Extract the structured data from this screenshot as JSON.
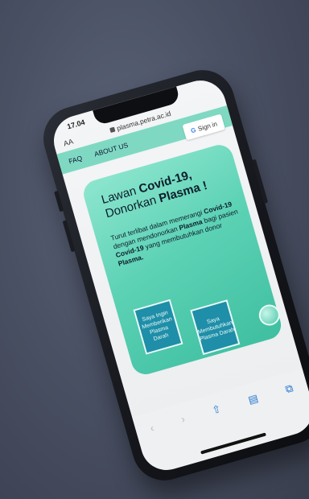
{
  "status": {
    "time": "17.04"
  },
  "browser": {
    "aa": "AA",
    "url": "plasma.petra.ac.id"
  },
  "nav": {
    "faq": "FAQ",
    "about": "ABOUT US",
    "signin": "Sign in",
    "signin_icon": "G"
  },
  "hero": {
    "title_line1": "Lawan",
    "title_line1_bold": "Covid-19,",
    "title_line2": "Donorkan",
    "title_line2_bold": "Plasma !",
    "desc_1": "Turut terlibat dalam memerangi ",
    "desc_bold_1": "Covid-19",
    "desc_2": " dengan mendonorkan ",
    "desc_bold_2": "Plasma",
    "desc_3": " bagi pasien ",
    "desc_bold_3": "Covid-19",
    "desc_4": " yang membutuhkan donor ",
    "desc_bold_4": "Plasma."
  },
  "buttons": {
    "give": "Saya Ingin Memberikan Plasma Darah",
    "need": "Saya Membutuhkan Plasma Darah"
  },
  "toolbar": {
    "back_icon": "chevron-left-icon",
    "forward_icon": "chevron-right-icon",
    "share_icon": "share-icon",
    "bookmarks_icon": "book-icon",
    "tabs_icon": "tabs-icon"
  },
  "colors": {
    "accent": "#5dd2b5",
    "button": "#1f8ea8",
    "nav_bar": "#7fd9c2"
  }
}
